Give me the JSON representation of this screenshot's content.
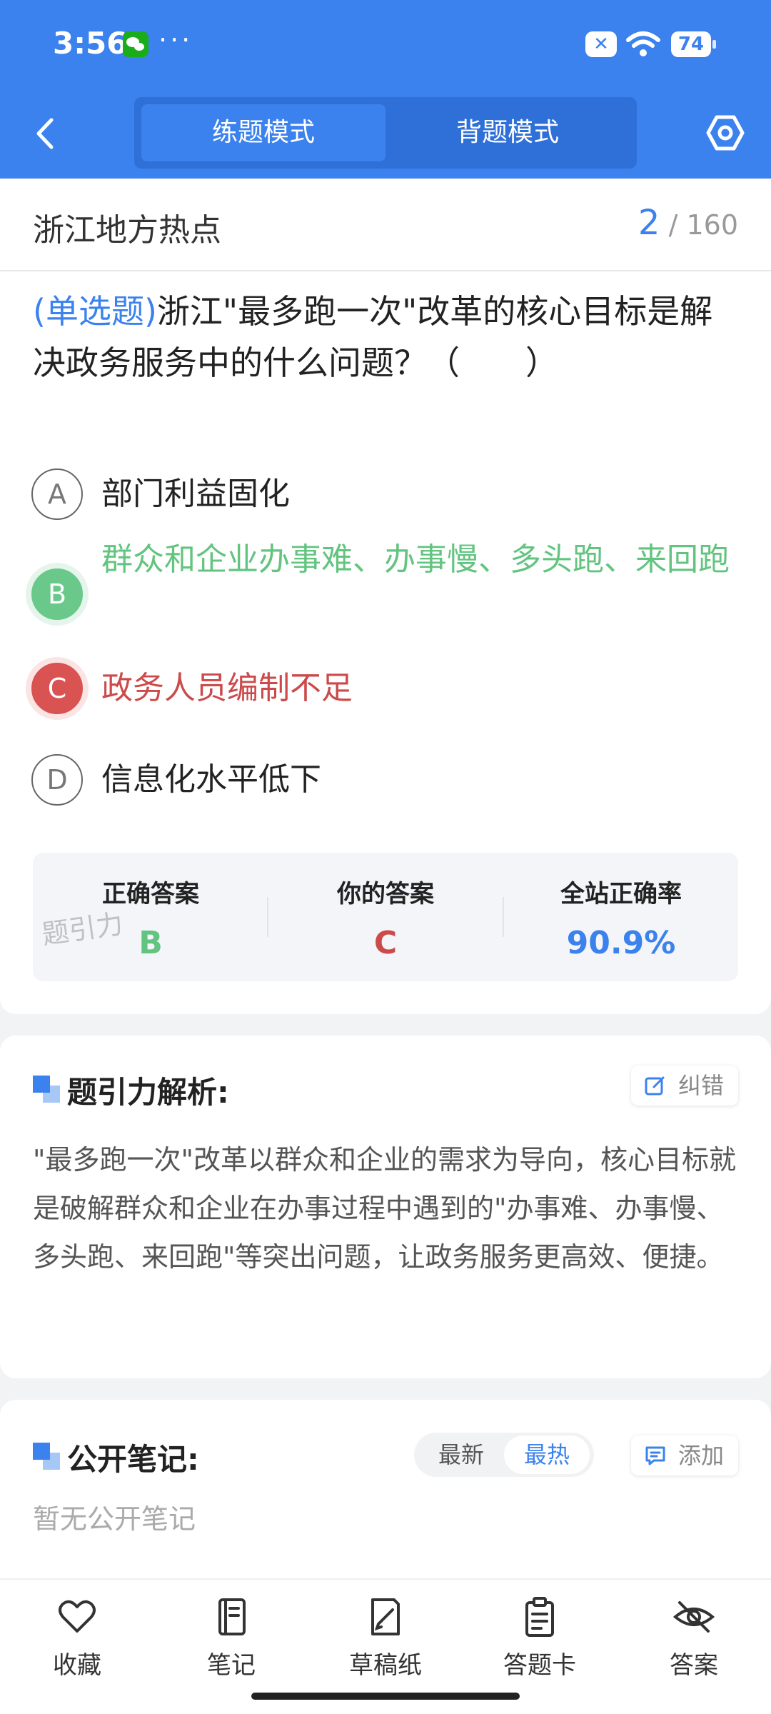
{
  "status_bar": {
    "time": "3:56",
    "dots": "···",
    "notif": "✕",
    "battery": "74"
  },
  "header": {
    "modes": [
      "练题模式",
      "背题模式"
    ]
  },
  "topic": {
    "name": "浙江地方热点",
    "current": "2",
    "separator": "/",
    "total": "160"
  },
  "question": {
    "type": "(单选题)",
    "text": "浙江\"最多跑一次\"改革的核心目标是解决政务服务中的什么问题？（　　）"
  },
  "options": [
    {
      "letter": "A",
      "text": "部门利益固化"
    },
    {
      "letter": "B",
      "text": "群众和企业办事难、办事慢、多头跑、来回跑"
    },
    {
      "letter": "C",
      "text": "政务人员编制不足"
    },
    {
      "letter": "D",
      "text": "信息化水平低下"
    }
  ],
  "answers": {
    "correct_label": "正确答案",
    "correct_value": "B",
    "yours_label": "你的答案",
    "yours_value": "C",
    "rate_label": "全站正确率",
    "rate_value": "90.9%",
    "watermark": "题引力"
  },
  "colors": {
    "primary": "#3b82ee",
    "correct": "#63c480",
    "wrong": "#cc4a4a"
  },
  "analysis": {
    "title": "题引力解析:",
    "report_label": "纠错",
    "text": "\"最多跑一次\"改革以群众和企业的需求为导向，核心目标就是破解群众和企业在办事过程中遇到的\"办事难、办事慢、多头跑、来回跑\"等突出问题，让政务服务更高效、便捷。"
  },
  "notes": {
    "title": "公开笔记:",
    "sort_latest": "最新",
    "sort_hot": "最热",
    "add_label": "添加",
    "empty": "暂无公开笔记"
  },
  "bottom_nav": [
    "收藏",
    "笔记",
    "草稿纸",
    "答题卡",
    "答案"
  ]
}
